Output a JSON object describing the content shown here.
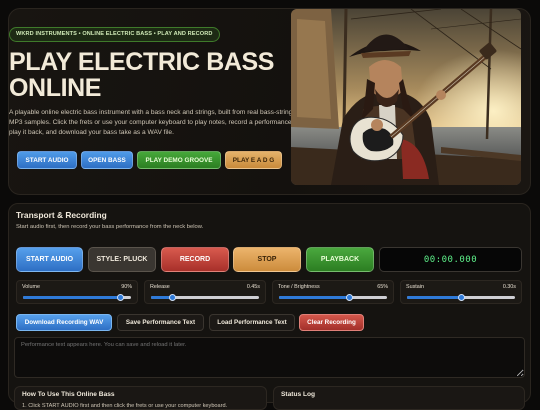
{
  "hero": {
    "tagline": "WKRD INSTRUMENTS • ONLINE ELECTRIC BASS • PLAY AND RECORD",
    "title": "PLAY ELECTRIC BASS ONLINE",
    "description": "A playable online electric bass instrument with a bass neck and strings, built from real bass-string MP3 samples. Click the frets or use your computer keyboard to play notes, record a performance, play it back, and download your bass take as a WAV file.",
    "buttons": {
      "start_audio": "START AUDIO",
      "open_bass": "OPEN BASS",
      "play_demo": "PLAY DEMO GROOVE",
      "play_eadg": "PLAY E A D G"
    },
    "image_alt": "Pirate playing an electric bass on a ship deck at sunset"
  },
  "transport": {
    "title": "Transport & Recording",
    "subtitle": "Start audio first, then record your bass performance from the neck below.",
    "buttons": {
      "start_audio": "START AUDIO",
      "style": "STYLE: PLUCK",
      "record": "RECORD",
      "stop": "STOP",
      "playback": "PLAYBACK"
    },
    "timer": "00:00.000",
    "sliders": [
      {
        "label": "Volume",
        "value": "90%",
        "fraction": 0.9
      },
      {
        "label": "Release",
        "value": "0.45s",
        "fraction": 0.2
      },
      {
        "label": "Tone / Brightness",
        "value": "65%",
        "fraction": 0.65
      },
      {
        "label": "Sustain",
        "value": "0.30s",
        "fraction": 0.5
      }
    ],
    "actions": {
      "download_wav": "Download Recording WAV",
      "save_text": "Save Performance Text",
      "load_text": "Load Performance Text",
      "clear": "Clear Recording"
    },
    "performance_placeholder": "Performance text appears here. You can save and reload it later."
  },
  "help": {
    "title": "How To Use This Online Bass",
    "first_line": "1. Click START AUDIO first and then click the frets or use your computer keyboard."
  },
  "status": {
    "title": "Status Log"
  },
  "colors": {
    "accent_blue": "#2e6fc4",
    "accent_green": "#2c7e22",
    "accent_red": "#a8302a",
    "accent_orange": "#cc8c3c",
    "timer_green": "#5ef08a"
  }
}
